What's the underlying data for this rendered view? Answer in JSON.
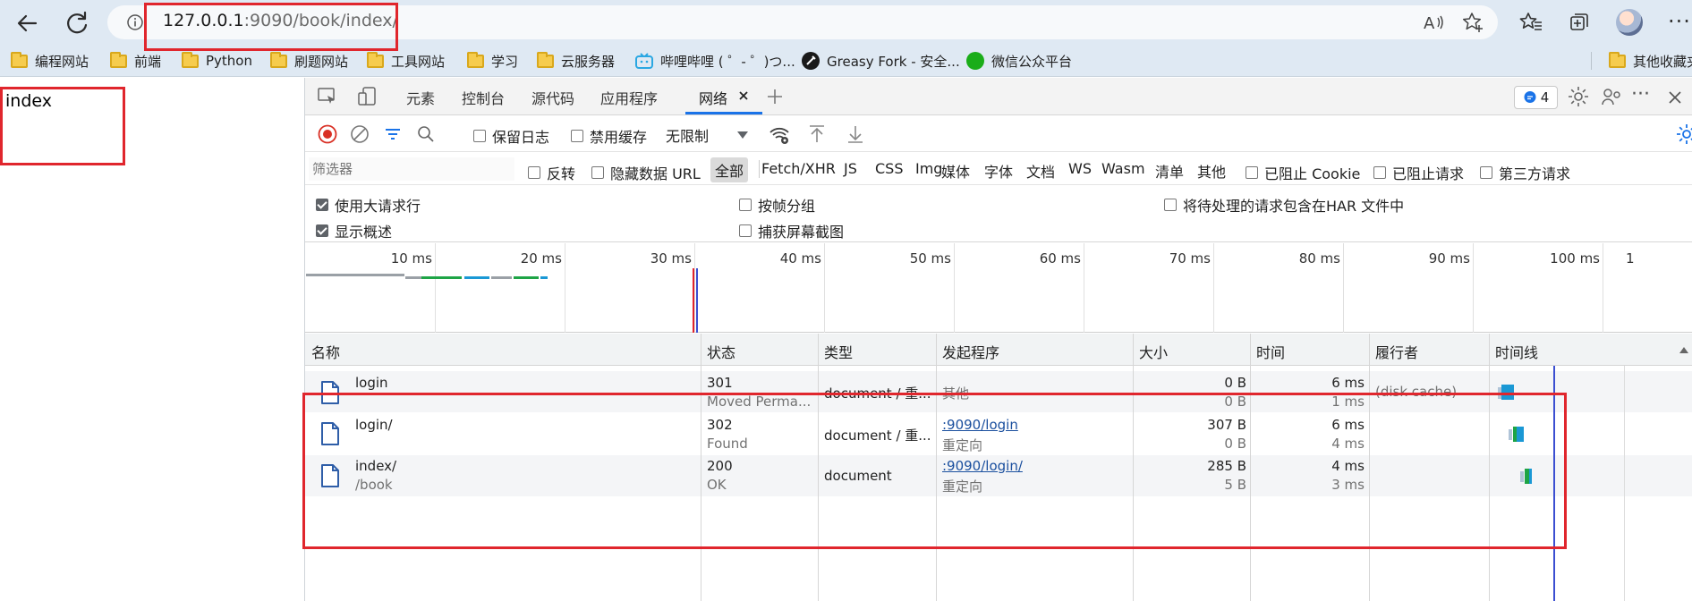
{
  "browser": {
    "url_host": "127.0.0.1",
    "url_rest": ":9090/book/index/"
  },
  "bookmarks": [
    {
      "label": "编程网站",
      "icon": "folder-icon"
    },
    {
      "label": "前端",
      "icon": "folder-icon"
    },
    {
      "label": "Python",
      "icon": "folder-icon"
    },
    {
      "label": "刷题网站",
      "icon": "folder-icon"
    },
    {
      "label": "工具网站",
      "icon": "folder-icon"
    },
    {
      "label": "学习",
      "icon": "folder-icon"
    },
    {
      "label": "云服务器",
      "icon": "folder-icon"
    },
    {
      "label": "哔哩哔哩 ( ゜- ゜)つ...",
      "icon": "bilibili-icon"
    },
    {
      "label": "Greasy Fork - 安全...",
      "icon": "greasyfork-icon"
    },
    {
      "label": "微信公众平台",
      "icon": "wechat-icon"
    },
    {
      "label": "其他收藏夹",
      "icon": "folder-icon"
    }
  ],
  "page": {
    "text": "index"
  },
  "devtools": {
    "tabs": [
      "元素",
      "控制台",
      "源代码",
      "应用程序",
      "网络"
    ],
    "active_tab": "网络",
    "issues_count": "4",
    "toolbar": {
      "preserve_log": "保留日志",
      "disable_cache": "禁用缓存",
      "throttle": "无限制"
    },
    "filter": {
      "placeholder": "筛选器",
      "invert": "反转",
      "hide_data_urls": "隐藏数据 URL",
      "types": [
        "全部",
        "Fetch/XHR",
        "JS",
        "CSS",
        "Img",
        "媒体",
        "字体",
        "文档",
        "WS",
        "Wasm",
        "清单",
        "其他"
      ],
      "blocked_cookies": "已阻止 Cookie",
      "blocked_requests": "已阻止请求",
      "third_party": "第三方请求"
    },
    "settings": {
      "big_rows": "使用大请求行",
      "group_by_frame": "按帧分组",
      "har_pending": "将待处理的请求包含在HAR 文件中",
      "show_overview": "显示概述",
      "screenshots": "捕获屏幕截图",
      "big_rows_checked": true,
      "show_overview_checked": true
    },
    "overview_ticks": [
      "10 ms",
      "20 ms",
      "30 ms",
      "40 ms",
      "50 ms",
      "60 ms",
      "70 ms",
      "80 ms",
      "90 ms",
      "100 ms",
      "1"
    ],
    "columns": [
      "名称",
      "状态",
      "类型",
      "发起程序",
      "大小",
      "时间",
      "履行者",
      "时间线"
    ],
    "rows": [
      {
        "name": "login",
        "path": "",
        "status": "301",
        "status_text": "Moved Perma...",
        "type": "document / 重...",
        "initiator": "其他",
        "initiator_sub": "",
        "size": "0 B",
        "size_sub": "0 B",
        "time": "6 ms",
        "time_sub": "1 ms",
        "fulfilled_by": "(disk cache)"
      },
      {
        "name": "login/",
        "path": "",
        "status": "302",
        "status_text": "Found",
        "type": "document / 重...",
        "initiator": ":9090/login",
        "initiator_sub": "重定向",
        "size": "307 B",
        "size_sub": "0 B",
        "time": "6 ms",
        "time_sub": "4 ms",
        "fulfilled_by": ""
      },
      {
        "name": "index/",
        "path": "/book",
        "status": "200",
        "status_text": "OK",
        "type": "document",
        "initiator": ":9090/login/",
        "initiator_sub": "重定向",
        "size": "285 B",
        "size_sub": "5 B",
        "time": "4 ms",
        "time_sub": "3 ms",
        "fulfilled_by": ""
      }
    ]
  }
}
